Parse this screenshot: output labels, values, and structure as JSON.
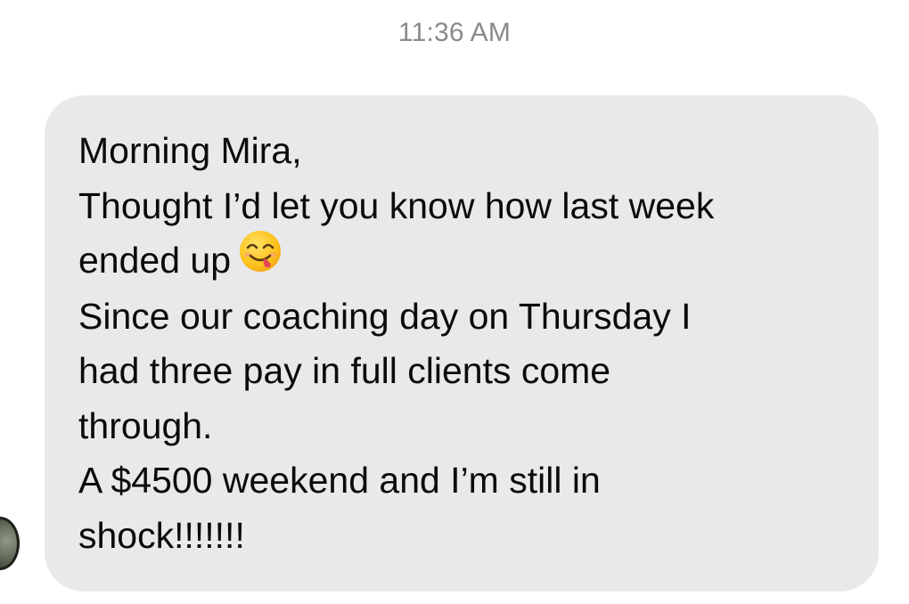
{
  "conversation": {
    "timestamp": "11:36 AM"
  },
  "message": {
    "lines": [
      "Morning Mira,",
      "Thought I’d let you know how last week",
      "ended up",
      "Since our coaching day on Thursday I",
      "had three pay in full clients come",
      "through.",
      "A $4500 weekend and I’m still in",
      "shock!!!!!!!"
    ],
    "emoji": "savoring-food-emoji"
  },
  "colors": {
    "bubble_bg": "#e9e9eb",
    "timestamp": "#8a8a8e",
    "text": "#0b0b0c",
    "page_bg": "#ffffff"
  }
}
